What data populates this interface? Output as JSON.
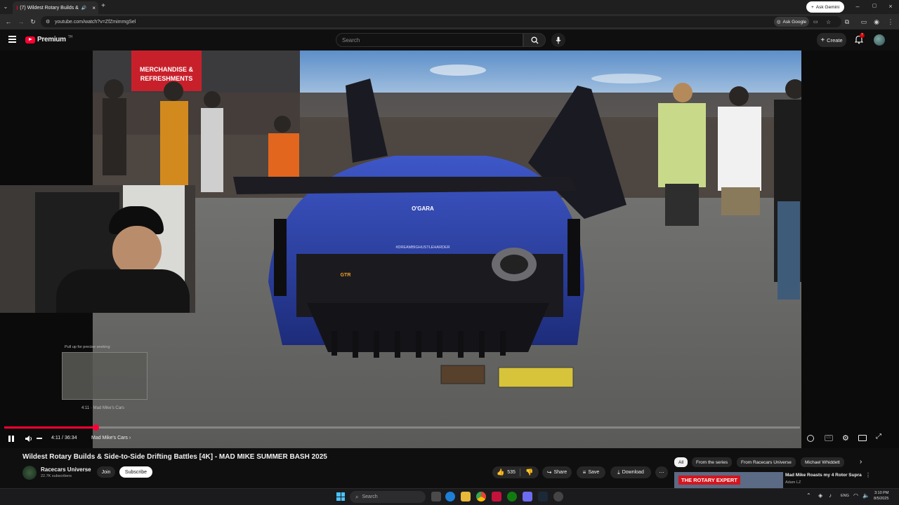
{
  "browser": {
    "tab_title": "(7) Wildest Rotary Builds &",
    "url": "youtube.com/watch?v=ZfZmimmgSel",
    "ask_gemini": "Ask Gemini",
    "ask_google": "Ask Google"
  },
  "youtube": {
    "logo_text": "Premium",
    "logo_sup": "TH",
    "search_placeholder": "Search",
    "create_label": "Create",
    "notification_count": "7"
  },
  "video": {
    "banner_line1": "MERCHANDISE &",
    "banner_line2": "REFRESHMENTS",
    "car_brand_1": "O'GARA",
    "car_brand_2": "GTR",
    "car_hashtag": "#DREAMBIGHUSTLEHARDER",
    "seek_hint": "Pull up for precise seeking",
    "preview_time": "4:11 · Mad Mike's Cars",
    "progress_fraction": 0.115
  },
  "controls": {
    "time": "4:11 / 36:34",
    "chapter": "Mad Mike's Cars ›"
  },
  "meta": {
    "title": "Wildest Rotary Builds & Side-to-Side Drifting Battles [4K] - MAD MIKE SUMMER BASH 2025",
    "channel": "Racecars Universe",
    "subscribers": "22.7K subscribers",
    "join": "Join",
    "subscribe": "Subscribe",
    "likes": "535",
    "share": "Share",
    "save": "Save",
    "download": "Download"
  },
  "chips": [
    "All",
    "From the series",
    "From Racecars Universe",
    "Michael Whiddett"
  ],
  "up_next": {
    "thumb_text": "THE ROTARY EXPERT",
    "title": "Mad Mike Roasts my 4 Rotor Supra",
    "channel": "Adam LZ"
  },
  "taskbar": {
    "search": "Search",
    "lang": "ENG",
    "time": "3:10 PM",
    "date": "8/5/2025"
  },
  "colors": {
    "accent": "#ff0033",
    "bg": "#0f0f0f"
  }
}
